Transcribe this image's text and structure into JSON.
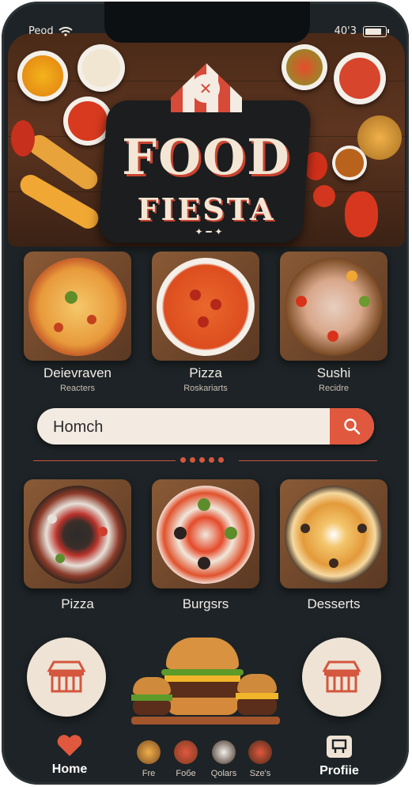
{
  "status": {
    "carrier": "Peod",
    "time": "40'3"
  },
  "app": {
    "title_line1": "FOOD",
    "title_line2": "FIESTA"
  },
  "top_cards": [
    {
      "title": "Deievraven",
      "subtitle": "Reacters"
    },
    {
      "title": "Pizza",
      "subtitle": "Roskariarts"
    },
    {
      "title": "Sushi",
      "subtitle": "Recidre"
    }
  ],
  "search": {
    "value": "Homch"
  },
  "bottom_cards": [
    {
      "title": "Pizza"
    },
    {
      "title": "Burgsrs"
    },
    {
      "title": "Desserts"
    }
  ],
  "nav": {
    "home": "Home",
    "items": [
      "Fre",
      "Foбe",
      "Qolars",
      "Sze's"
    ],
    "profile": "Profiie"
  },
  "colors": {
    "accent": "#e0583e",
    "background": "#1d2326",
    "cream": "#f3ebe2"
  }
}
